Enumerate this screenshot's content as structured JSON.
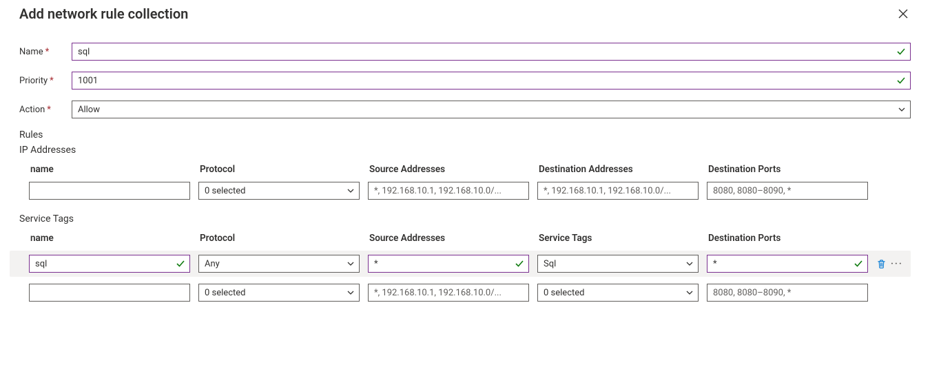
{
  "header": {
    "title": "Add network rule collection"
  },
  "form": {
    "name": {
      "label": "Name",
      "value": "sql"
    },
    "priority": {
      "label": "Priority",
      "value": "1001"
    },
    "action": {
      "label": "Action",
      "value": "Allow"
    }
  },
  "rulesLabel": "Rules",
  "ip_section": {
    "title": "IP Addresses",
    "columns": [
      "name",
      "Protocol",
      "Source Addresses",
      "Destination Addresses",
      "Destination Ports"
    ],
    "rows": [
      {
        "name": "",
        "protocol": "0 selected",
        "source_placeholder": "*, 192.168.10.1, 192.168.10.0/...",
        "dest_addr_placeholder": "*, 192.168.10.1, 192.168.10.0/...",
        "dest_ports_placeholder": "8080, 8080–8090, *"
      }
    ]
  },
  "tag_section": {
    "title": "Service Tags",
    "columns": [
      "name",
      "Protocol",
      "Source Addresses",
      "Service Tags",
      "Destination Ports"
    ],
    "rows": [
      {
        "name": "sql",
        "protocol": "Any",
        "source": "*",
        "service_tag": "Sql",
        "dest_ports": "*"
      },
      {
        "name": "",
        "protocol": "0 selected",
        "source_placeholder": "*, 192.168.10.1, 192.168.10.0/...",
        "service_tag": "0 selected",
        "dest_ports_placeholder": "8080, 8080–8090, *"
      }
    ]
  }
}
